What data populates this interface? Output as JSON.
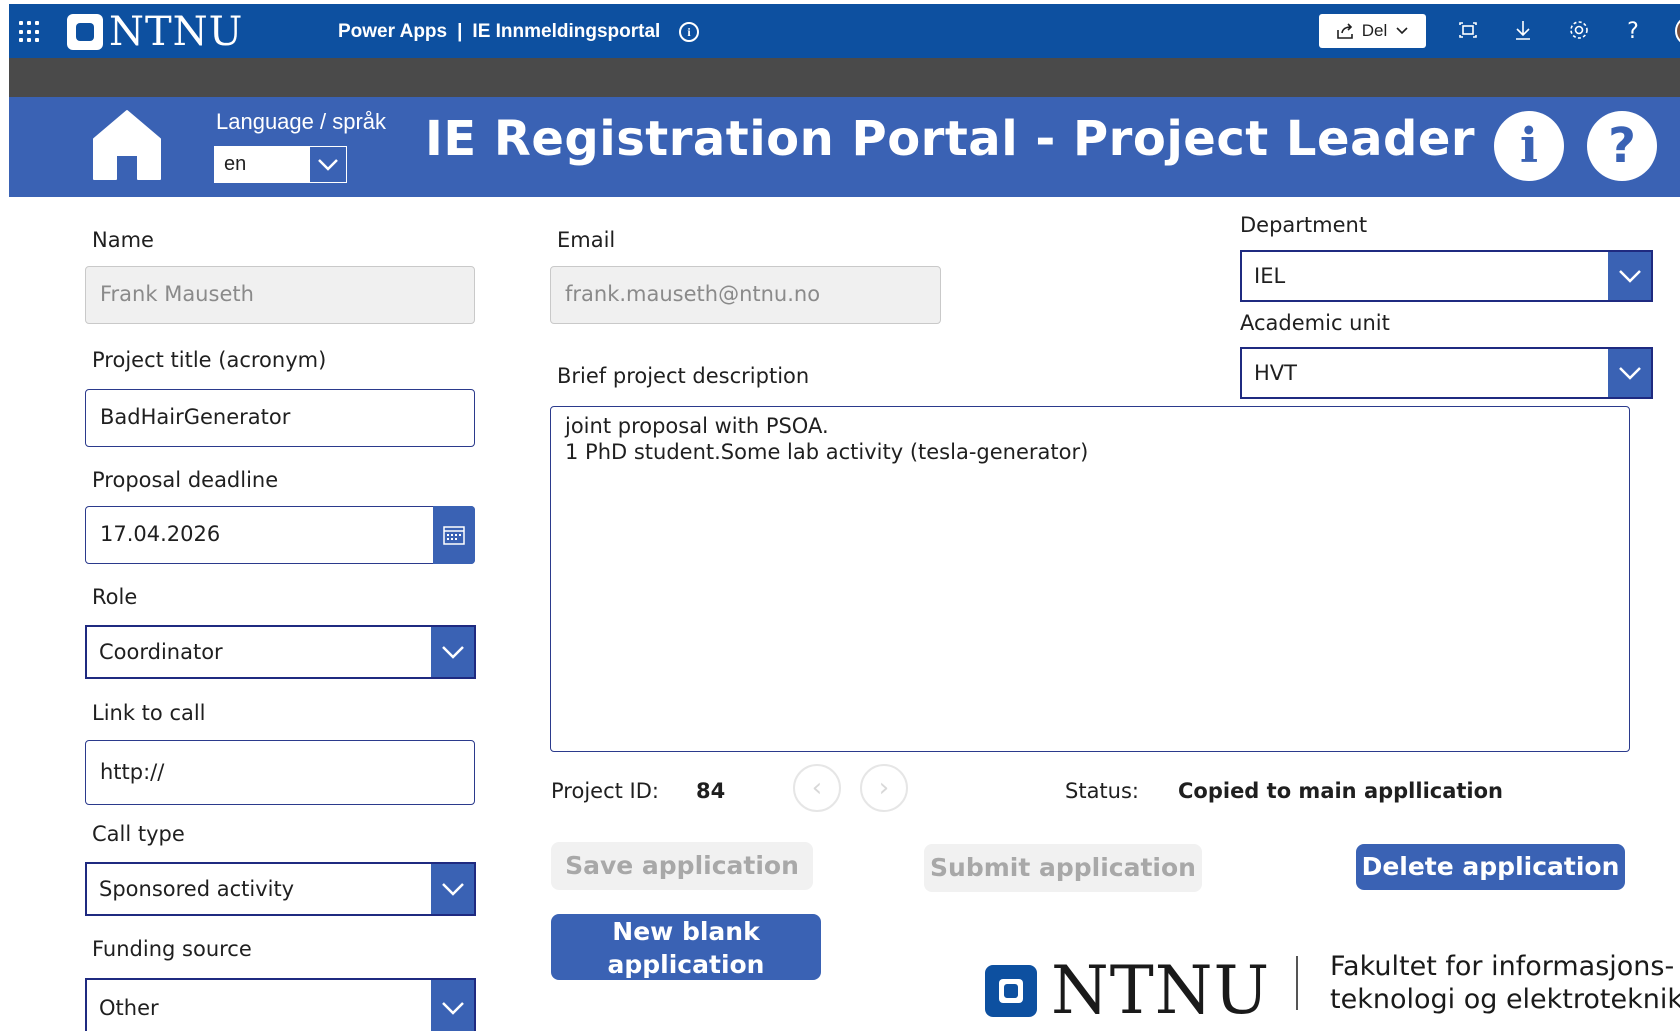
{
  "suite": {
    "logo_text": "NTNU",
    "app_name": "Power Apps",
    "separator": "|",
    "page_name": "IE Innmeldingsportal",
    "share_label": "Del",
    "icons": [
      "waffle-icon",
      "info-icon",
      "share-icon",
      "fit-screen-icon",
      "download-icon",
      "settings-icon",
      "help-icon",
      "avatar"
    ]
  },
  "header": {
    "language_label": "Language / språk",
    "language_value": "en",
    "title": "IE Registration Portal - Project Leader",
    "info_glyph": "i",
    "help_glyph": "?"
  },
  "form": {
    "name_label": "Name",
    "name_value": "Frank Mauseth",
    "email_label": "Email",
    "email_value": "frank.mauseth@ntnu.no",
    "department_label": "Department",
    "department_value": "IEL",
    "academic_unit_label": "Academic unit",
    "academic_unit_value": "HVT",
    "project_title_label": "Project title (acronym)",
    "project_title_value": "BadHairGenerator",
    "description_label": "Brief project description",
    "description_line1": "joint proposal with PSOA.",
    "description_line2": "1 PhD student.Some lab activity (tesla-generator)",
    "deadline_label": "Proposal deadline",
    "deadline_value": "17.04.2026",
    "role_label": "Role",
    "role_value": "Coordinator",
    "link_label": "Link to call",
    "link_value": "http://",
    "call_type_label": "Call type",
    "call_type_value": "Sponsored activity",
    "funding_label": "Funding source",
    "funding_value": "Other"
  },
  "meta": {
    "project_id_label": "Project ID:",
    "project_id_value": "84",
    "status_label": "Status:",
    "status_value": "Copied to main appllication"
  },
  "buttons": {
    "save": "Save application",
    "submit": "Submit application",
    "delete": "Delete application",
    "new_line1": "New blank",
    "new_line2": "application"
  },
  "footer": {
    "logo_text": "NTNU",
    "faculty_line1": "Fakultet for informasjons-",
    "faculty_line2": "teknologi og elektroteknikk"
  },
  "colors": {
    "suite_bar": "#0d50a0",
    "app_header": "#3a62b4",
    "primary_button": "#3a62b4",
    "input_border": "#2b3a8c"
  }
}
